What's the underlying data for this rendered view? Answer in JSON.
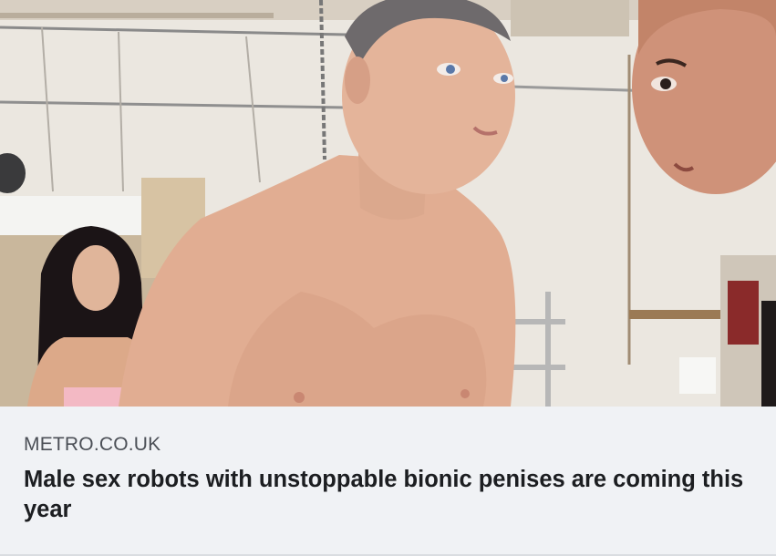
{
  "link_preview": {
    "source": "METRO.CO.UK",
    "headline": "Male sex robots with unstoppable bionic penises are coming this year"
  },
  "colors": {
    "caption_background": "#f0f2f5",
    "source_text": "#4b4f56",
    "headline_text": "#1c1e21"
  }
}
